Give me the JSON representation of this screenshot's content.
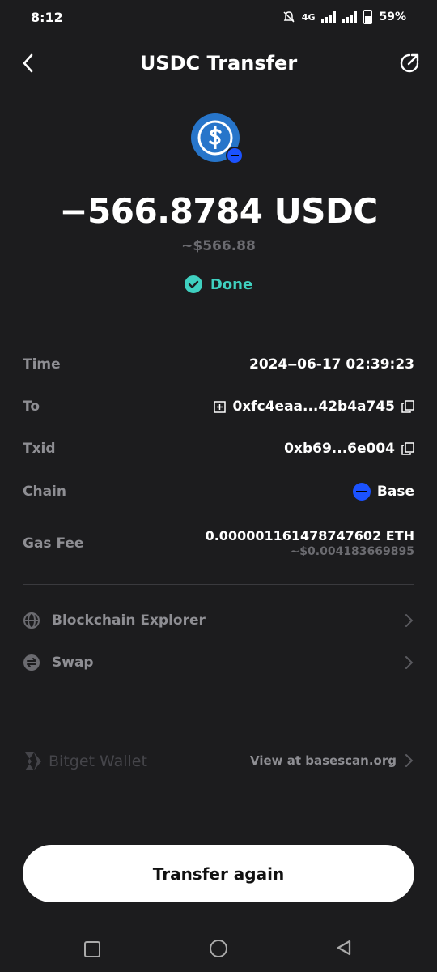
{
  "status_bar": {
    "time": "8:12",
    "network": "4G",
    "battery": "59%"
  },
  "header": {
    "title": "USDC Transfer"
  },
  "transfer": {
    "amount": "−566.8784 USDC",
    "fiat": "~$566.88",
    "status": "Done"
  },
  "details": {
    "time": {
      "label": "Time",
      "value": "2024‒06‑17 02:39:23"
    },
    "to": {
      "label": "To",
      "value": "0xfc4eaa...42b4a745"
    },
    "txid": {
      "label": "Txid",
      "value": "0xb69...6e004"
    },
    "chain": {
      "label": "Chain",
      "value": "Base"
    },
    "gas": {
      "label": "Gas Fee",
      "value": "0.000001161478747602 ETH",
      "fiat": "~$0.004183669895"
    }
  },
  "links": {
    "explorer": "Blockchain Explorer",
    "swap": "Swap"
  },
  "footer": {
    "brand": "Bitget Wallet",
    "view_at": "View at basescan.org"
  },
  "cta": {
    "label": "Transfer again"
  },
  "colors": {
    "background": "#1c1c1e",
    "accent": "#3fd0c0",
    "usdc": "#2775ca",
    "base": "#1b52ff",
    "muted": "#8e8e93"
  }
}
